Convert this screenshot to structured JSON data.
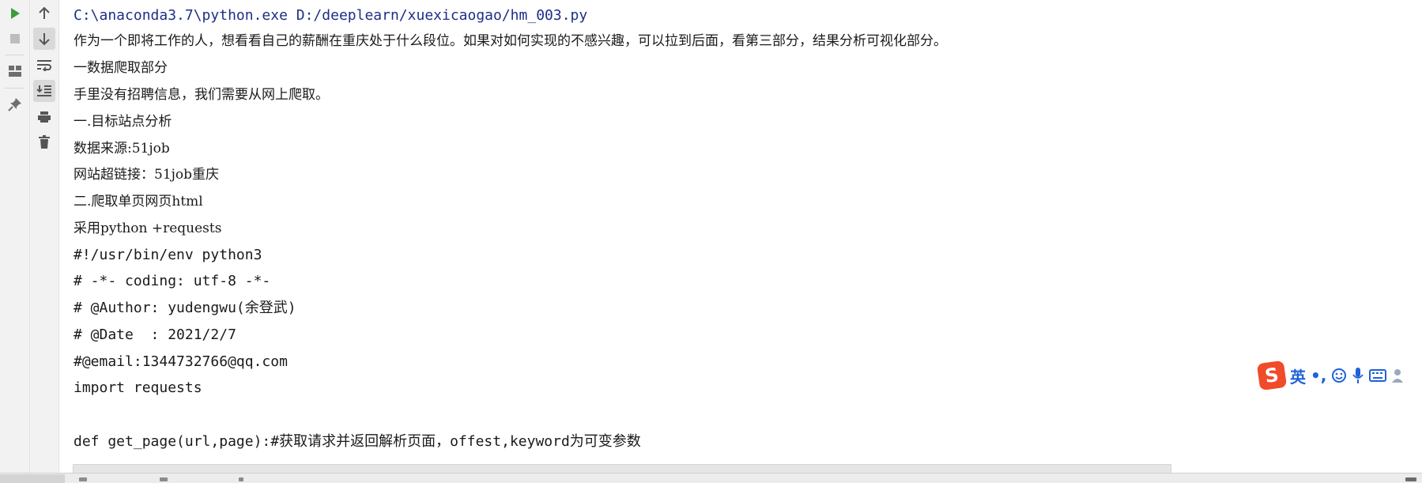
{
  "toolbar": {
    "run_icon": "play-icon",
    "stop_icon": "stop-icon",
    "layout_icon": "layout-icon",
    "pin_icon": "pin-icon",
    "up_icon": "arrow-up-icon",
    "down_icon": "arrow-down-icon",
    "wrap_icon": "soft-wrap-icon",
    "scroll_end_icon": "scroll-to-end-icon",
    "print_icon": "print-icon",
    "trash_icon": "trash-icon"
  },
  "console": {
    "lines": [
      "C:\\anaconda3.7\\python.exe D:/deeplearn/xuexicaogao/hm_003.py",
      "作为一个即将工作的人，想看看自己的薪酬在重庆处于什么段位。如果对如何实现的不感兴趣，可以拉到后面，看第三部分，结果分析可视化部分。",
      "一数据爬取部分",
      "手里没有招聘信息，我们需要从网上爬取。",
      "一.目标站点分析",
      "数据来源:51job",
      "网站超链接：51job重庆",
      "二.爬取单页网页html",
      "采用python +requests",
      "#!/usr/bin/env python3",
      "# -*- coding: utf-8 -*-",
      "# @Author: yudengwu(余登武)",
      "# @Date  : 2021/2/7",
      "#@email:1344732766@qq.com",
      "import requests",
      "",
      "def get_page(url,page):#获取请求并返回解析页面，offest,keyword为可变参数"
    ]
  },
  "ime": {
    "logo": "S",
    "mode": "英",
    "punct": "•,"
  },
  "colors": {
    "command": "#1d2f88",
    "text": "#1a1a1a",
    "run": "#3b9c3b",
    "ime_logo": "#f04b2a",
    "ime_blue": "#1e62d6"
  }
}
